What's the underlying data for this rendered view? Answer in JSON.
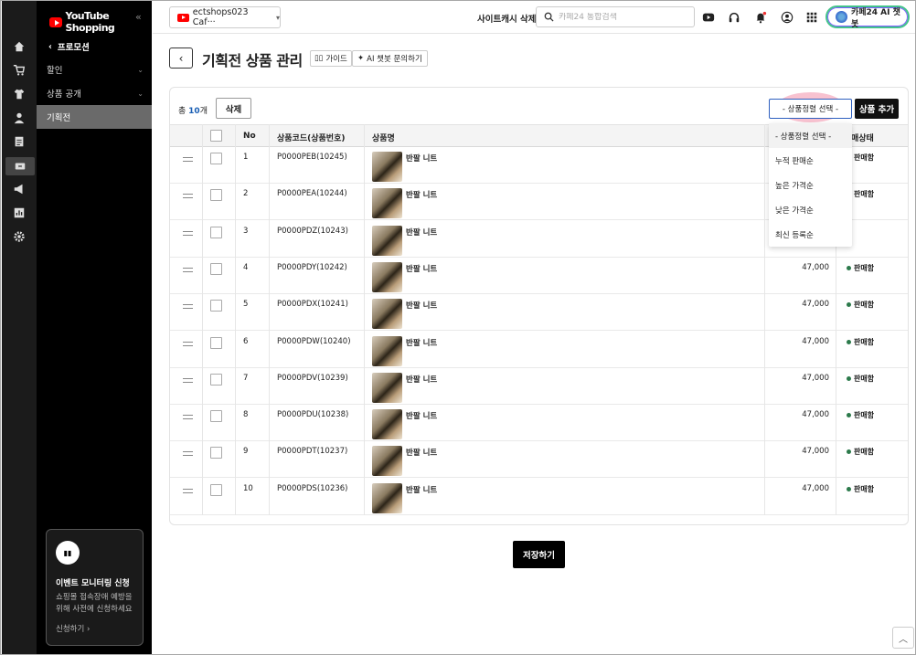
{
  "brand": {
    "name": "YouTube Shopping"
  },
  "sidebar": {
    "back_label": "프로모션",
    "items": [
      {
        "label": "할인",
        "chevron": "⌄"
      },
      {
        "label": "상품 공개",
        "chevron": "⌄"
      },
      {
        "label": "기획전"
      }
    ],
    "card": {
      "icon": "chart-icon",
      "title": "이벤트 모니터링 신청",
      "desc": "쇼핑몰 접속장애 예방을 위해 사전에 신청하세요",
      "link": "신청하기 ›"
    }
  },
  "rail_icons": [
    "home-icon",
    "cart-icon",
    "shirt-icon",
    "user-icon",
    "document-icon",
    "ticket-icon",
    "megaphone-icon",
    "stats-icon",
    "settings-icon"
  ],
  "topbar": {
    "shop_name": "ectshops023 Caf···",
    "cache_button": "사이트캐시 삭제",
    "search_placeholder": "카페24 통합검색",
    "ai_button": "카페24 AI 챗봇"
  },
  "page": {
    "title": "기획전 상품 관리",
    "guide_label": "가이드",
    "ai_question_label": "AI 챗봇 문의하기",
    "total_prefix": "총",
    "total_count": "10",
    "total_suffix": "개",
    "delete_label": "삭제",
    "sort_label": "- 상품정렬 선택 -",
    "add_label": "상품 추가",
    "save_label": "저장하기"
  },
  "table": {
    "headers": {
      "no": "No",
      "code": "상품코드(상품번호)",
      "name": "상품명",
      "status": "매상태"
    },
    "rows": [
      {
        "no": "1",
        "code": "P0000PEB(10245)",
        "name": "반팔 니트",
        "price": "",
        "status": "판매함"
      },
      {
        "no": "2",
        "code": "P0000PEA(10244)",
        "name": "반팔 니트",
        "price": "",
        "status": "판매함"
      },
      {
        "no": "3",
        "code": "P0000PDZ(10243)",
        "name": "반팔 니트",
        "price": "",
        "status": ""
      },
      {
        "no": "4",
        "code": "P0000PDY(10242)",
        "name": "반팔 니트",
        "price": "47,000",
        "status": "판매함"
      },
      {
        "no": "5",
        "code": "P0000PDX(10241)",
        "name": "반팔 니트",
        "price": "47,000",
        "status": "판매함"
      },
      {
        "no": "6",
        "code": "P0000PDW(10240)",
        "name": "반팔 니트",
        "price": "47,000",
        "status": "판매함"
      },
      {
        "no": "7",
        "code": "P0000PDV(10239)",
        "name": "반팔 니트",
        "price": "47,000",
        "status": "판매함"
      },
      {
        "no": "8",
        "code": "P0000PDU(10238)",
        "name": "반팔 니트",
        "price": "47,000",
        "status": "판매함"
      },
      {
        "no": "9",
        "code": "P0000PDT(10237)",
        "name": "반팔 니트",
        "price": "47,000",
        "status": "판매함"
      },
      {
        "no": "10",
        "code": "P0000PDS(10236)",
        "name": "반팔 니트",
        "price": "47,000",
        "status": "판매함"
      }
    ]
  },
  "sort_dropdown": {
    "options": [
      "- 상품정렬 선택 -",
      "누적 판매순",
      "높은 가격순",
      "낮은 가격순",
      "최신 등록순"
    ],
    "selected_index": 0
  },
  "colors": {
    "accent": "#2d5fbf",
    "status_dot": "#2c7a4b",
    "brand_red": "#ff0000"
  }
}
